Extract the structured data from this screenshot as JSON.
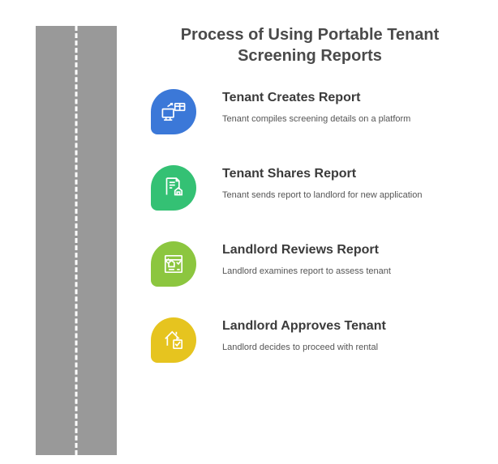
{
  "title": "Process of Using Portable Tenant Screening Reports",
  "steps": [
    {
      "color": "#3b78d8",
      "icon": "monitor-transfer-icon",
      "heading": "Tenant Creates Report",
      "desc": "Tenant compiles screening details on a platform"
    },
    {
      "color": "#34c174",
      "icon": "document-house-icon",
      "heading": "Tenant Shares Report",
      "desc": "Tenant sends report to landlord for new application"
    },
    {
      "color": "#8cc63f",
      "icon": "report-checklist-icon",
      "heading": "Landlord Reviews Report",
      "desc": "Landlord examines report to assess tenant"
    },
    {
      "color": "#e6c41f",
      "icon": "house-check-icon",
      "heading": "Landlord Approves Tenant",
      "desc": "Landlord decides to proceed with rental"
    }
  ]
}
